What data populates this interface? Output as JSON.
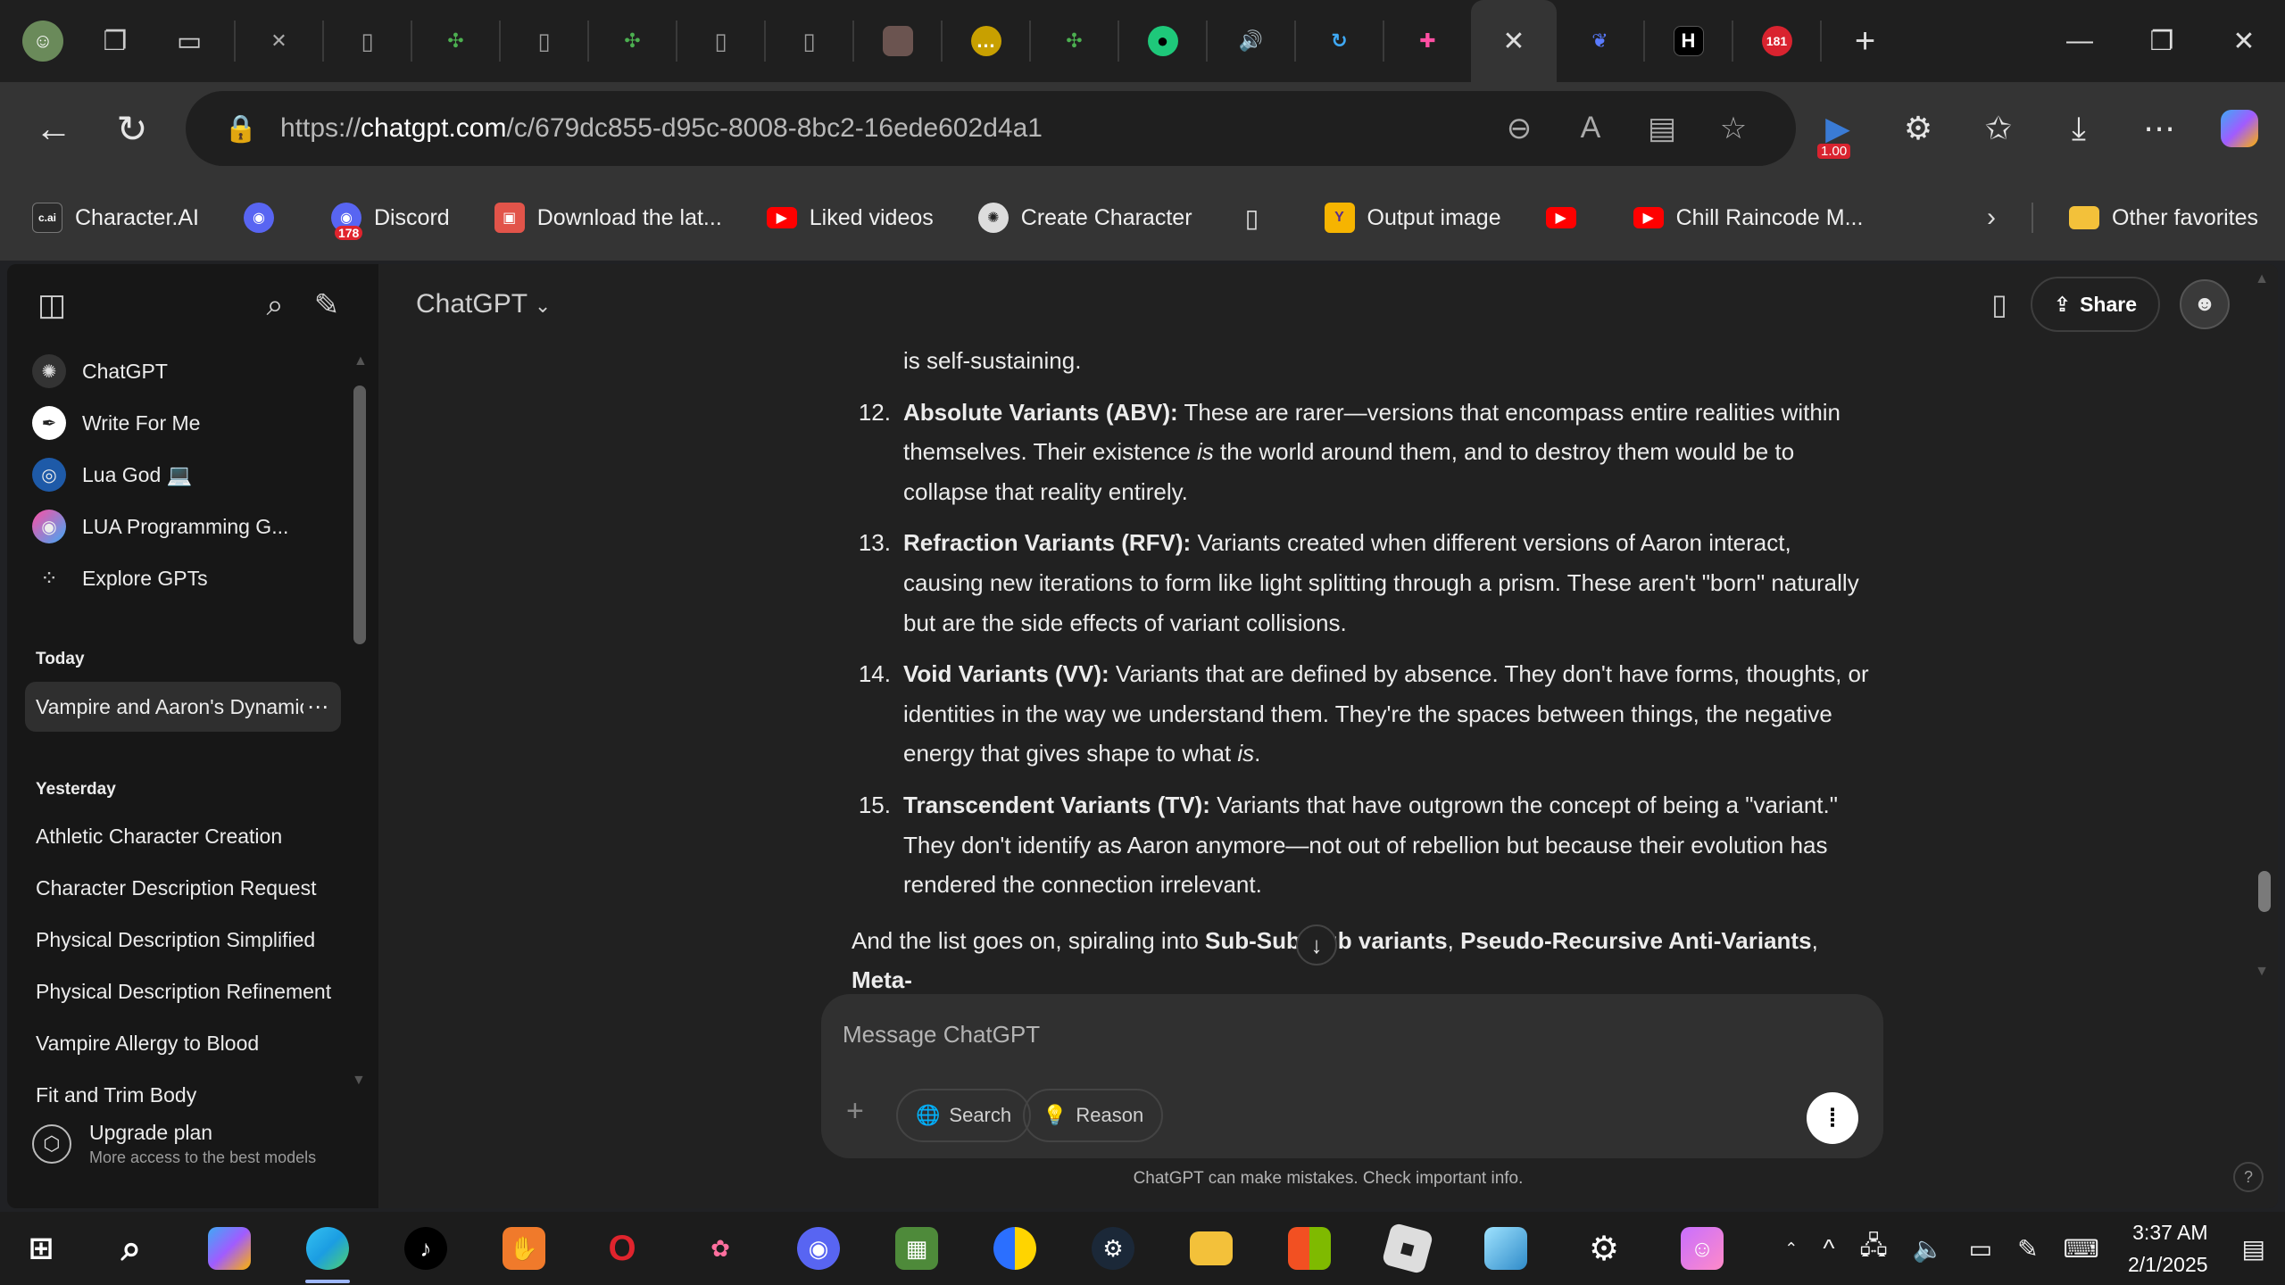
{
  "browser": {
    "url_prefix": "https://",
    "url_host": "chatgpt.com",
    "url_path": "/c/679dc855-d95c-8008-8bc2-16ede602d4a1",
    "extension_badge": "1.00",
    "tab_badge": "181"
  },
  "favorites": [
    {
      "label": "Character.AI",
      "icon": "c.ai",
      "color": "#2b2b2b"
    },
    {
      "label": "",
      "icon": "discord-icon",
      "color": "#5865f2"
    },
    {
      "label": "Discord",
      "icon": "discord-icon",
      "color": "#5865f2",
      "badge": "178"
    },
    {
      "label": "Download the lat...",
      "icon": "store-icon",
      "color": "#e2544a"
    },
    {
      "label": "Liked videos",
      "icon": "youtube-icon",
      "color": "#ff0000"
    },
    {
      "label": "Create Character",
      "icon": "openai-icon",
      "color": "#444"
    },
    {
      "label": "",
      "icon": "document-icon",
      "color": "transparent"
    },
    {
      "label": "Output image",
      "icon": "y-icon",
      "color": "#f6b400"
    },
    {
      "label": "",
      "icon": "youtube-icon",
      "color": "#ff0000"
    },
    {
      "label": "Chill Raincode M...",
      "icon": "youtube-icon",
      "color": "#ff0000"
    }
  ],
  "favorites_other": "Other favorites",
  "sidebar": {
    "gpts": [
      {
        "label": "ChatGPT"
      },
      {
        "label": "Write For Me"
      },
      {
        "label": "Lua God 💻"
      },
      {
        "label": "LUA Programming G..."
      },
      {
        "label": "Explore GPTs"
      }
    ],
    "today_heading": "Today",
    "today_chats": [
      "Vampire and Aaron's Dynamic"
    ],
    "yesterday_heading": "Yesterday",
    "yesterday_chats": [
      "Athletic Character Creation",
      "Character Description Request",
      "Physical Description Simplified",
      "Physical Description Refinement",
      "Vampire Allergy to Blood",
      "Fit and Trim Body"
    ],
    "upgrade_title": "Upgrade plan",
    "upgrade_sub": "More access to the best models"
  },
  "header": {
    "model": "ChatGPT",
    "share": "Share"
  },
  "transcript": {
    "cut_top": "is self-sustaining.",
    "items": [
      {
        "num": "12.",
        "title": "Absolute Variants (ABV):",
        "pre": " These are rarer—versions that encompass entire realities within themselves. Their existence ",
        "em": "is",
        "post": " the world around them, and to destroy them would be to collapse that reality entirely."
      },
      {
        "num": "13.",
        "title": "Refraction Variants (RFV):",
        "pre": " Variants created when different versions of Aaron interact, causing new iterations to form like light splitting through a prism. These aren't \"born\" naturally but are the side effects of variant collisions.",
        "em": "",
        "post": ""
      },
      {
        "num": "14.",
        "title": "Void Variants (VV):",
        "pre": " Variants that are defined by absence. They don't have forms, thoughts, or identities in the way we understand them. They're the spaces between things, the negative energy that gives shape to what ",
        "em": "is",
        "post": "."
      },
      {
        "num": "15.",
        "title": "Transcendent Variants (TV):",
        "pre": " Variants that have outgrown the concept of being a \"variant.\" They don't identify as Aaron anymore—not out of rebellion but because their evolution has rendered the connection irrelevant.",
        "em": "",
        "post": ""
      }
    ],
    "tail_pre": "And the list goes on, spiraling into ",
    "tail_b1": "Sub-Sub-Sub variants",
    "tail_mid": ", ",
    "tail_b2": "Pseudo-Recursive Anti-Variants",
    "tail_mid2": ", ",
    "tail_b3": "Meta-"
  },
  "composer": {
    "placeholder": "Message ChatGPT",
    "search": "Search",
    "reason": "Reason"
  },
  "disclaimer": "ChatGPT can make mistakes. Check important info.",
  "taskbar": {
    "time": "3:37 AM",
    "date": "2/1/2025"
  }
}
